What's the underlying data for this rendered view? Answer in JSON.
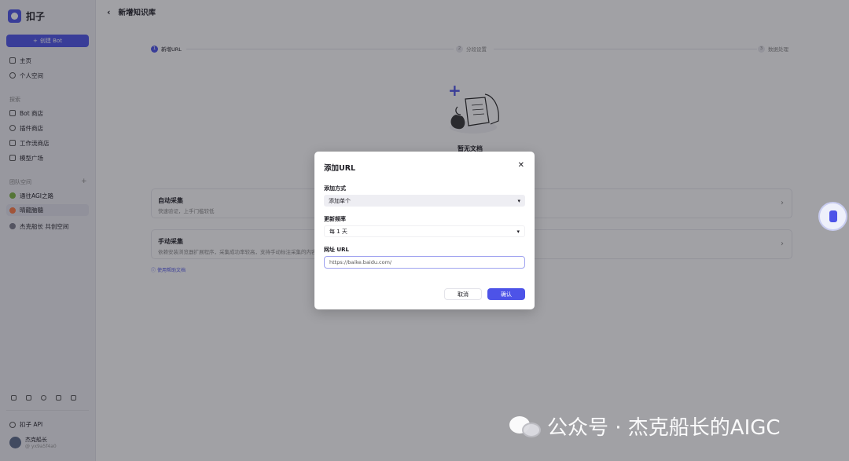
{
  "app": {
    "name": "扣子"
  },
  "sidebar": {
    "create_label": "创建 Bot",
    "home": "主页",
    "personal": "个人空间",
    "explore_label": "探索",
    "explore": [
      "Bot 商店",
      "插件商店",
      "工作流商店",
      "模型广场"
    ],
    "team_label": "团队空间",
    "teams": [
      "通往AGI之路",
      "晴龍脑髓",
      "杰克船长 共创空间"
    ],
    "api": "扣子 API",
    "user": {
      "name": "杰克船长",
      "id": "@ yx9a5f4a0"
    }
  },
  "page": {
    "title": "新增知识库",
    "steps": [
      {
        "num": "1",
        "label": "新增URL"
      },
      {
        "num": "2",
        "label": "分段设置"
      },
      {
        "num": "3",
        "label": "数据处理"
      }
    ],
    "empty_text": "暂无文档",
    "options": [
      {
        "title": "自动采集",
        "desc": "快速验证，上手门槛较低"
      },
      {
        "title": "手动采集",
        "desc": "依赖安装浏览器扩展程序，采集成功率较高，支持手动标注采集的内容"
      }
    ],
    "help_link": "使用帮助文档"
  },
  "modal": {
    "title": "添加URL",
    "method_label": "添加方式",
    "method_value": "添加单个",
    "frequency_label": "更新频率",
    "frequency_value": "每 1 天",
    "url_label": "网址 URL",
    "url_value": "https://baike.baidu.com/",
    "cancel": "取消",
    "confirm": "确认"
  },
  "watermark": {
    "text": "公众号 · 杰克船长的AIGC"
  },
  "colors": {
    "accent": "#4d53e8"
  }
}
